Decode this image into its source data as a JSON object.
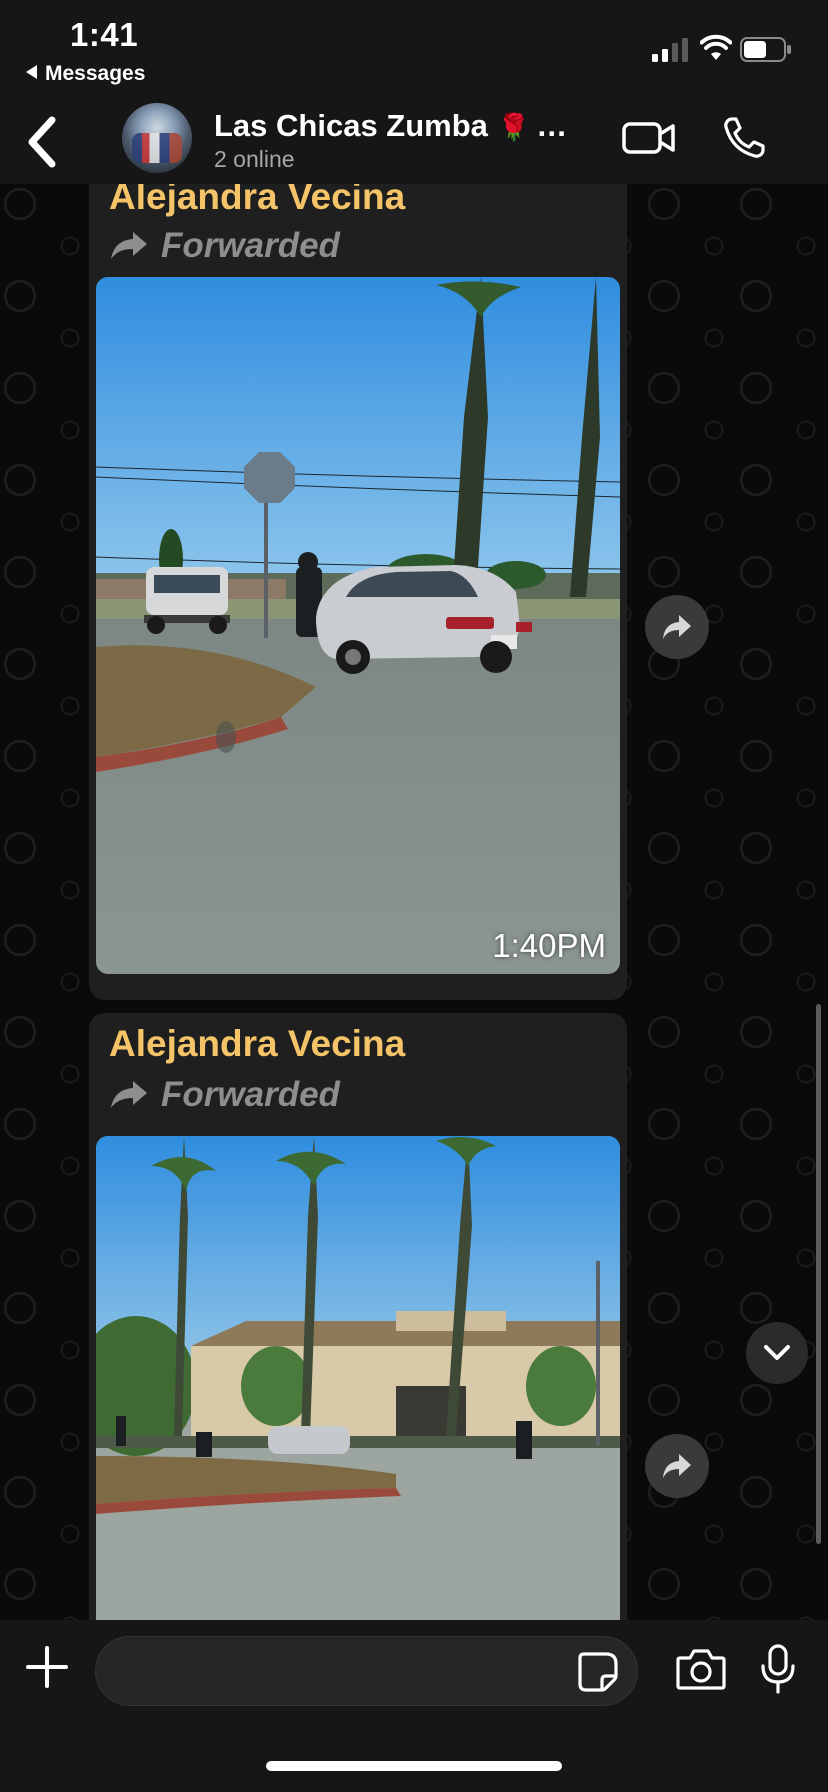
{
  "status_bar": {
    "time": "1:41",
    "back_to_app": "Messages"
  },
  "header": {
    "title": "Las Chicas Zumba",
    "title_emoji": "🌹",
    "title_ellipsis": "…",
    "subtitle": "2 online",
    "icons": [
      "back-chevron-icon",
      "video-call-icon",
      "phone-call-icon"
    ]
  },
  "messages": [
    {
      "sender": "Alejandra Vecina",
      "forwarded_label": "Forwarded",
      "time": "1:40PM",
      "media": "photo"
    },
    {
      "sender": "Alejandra Vecina",
      "forwarded_label": "Forwarded",
      "media": "photo"
    }
  ],
  "input_bar": {
    "placeholder": "",
    "icons": [
      "plus-icon",
      "sticker-icon",
      "camera-icon",
      "microphone-icon"
    ]
  },
  "colors": {
    "background": "#0b0b0b",
    "bar": "#161616",
    "bubble": "#1f1f1f",
    "sender_name": "#f5c468",
    "muted_text": "#8e8e8e"
  }
}
